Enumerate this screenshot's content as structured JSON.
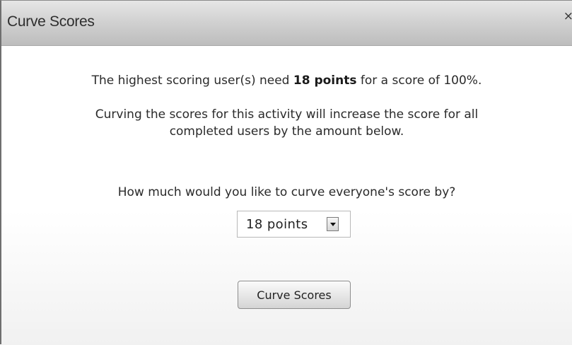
{
  "dialog": {
    "title": "Curve Scores",
    "close_label": "×"
  },
  "message": {
    "line1_before": "The highest scoring user(s) need ",
    "line1_bold": "18 points",
    "line1_after": " for a score of 100%.",
    "line2": "Curving the scores for this activity will increase the score for all",
    "line3": "completed users by the amount below.",
    "question": "How much would you like to curve everyone's score by?"
  },
  "curve_select": {
    "selected": "18 points"
  },
  "actions": {
    "submit_label": "Curve Scores"
  }
}
